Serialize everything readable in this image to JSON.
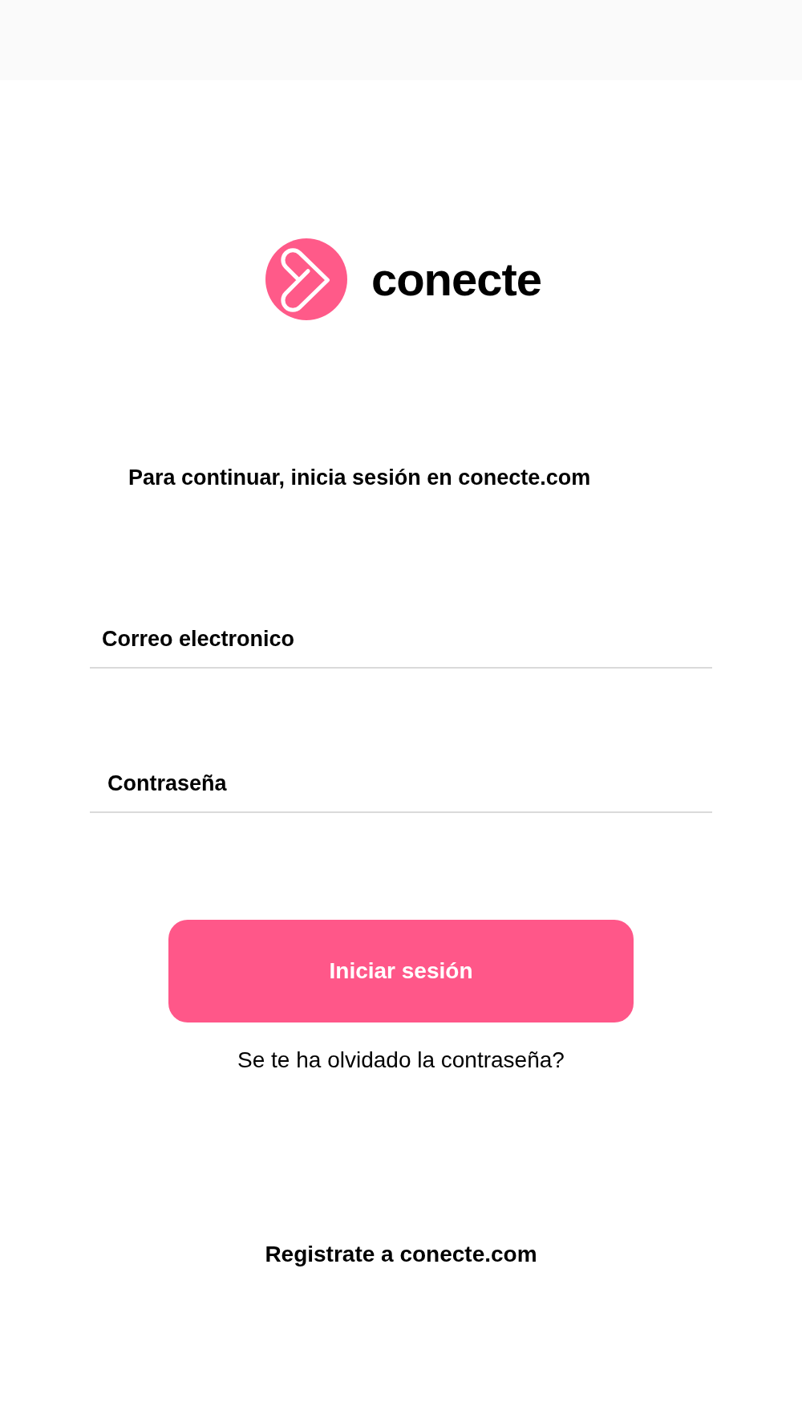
{
  "logo": {
    "wordmark": "conecte"
  },
  "prompt": "Para continuar, inicia sesión en conecte.com",
  "fields": [
    {
      "placeholder": "Correo electronico"
    },
    {
      "placeholder": "Contraseña"
    }
  ],
  "login_button": "Iniciar sesión",
  "forgot_link": "Se te ha olvidado la contraseña?",
  "register_link": "Registrate a conecte.com"
}
